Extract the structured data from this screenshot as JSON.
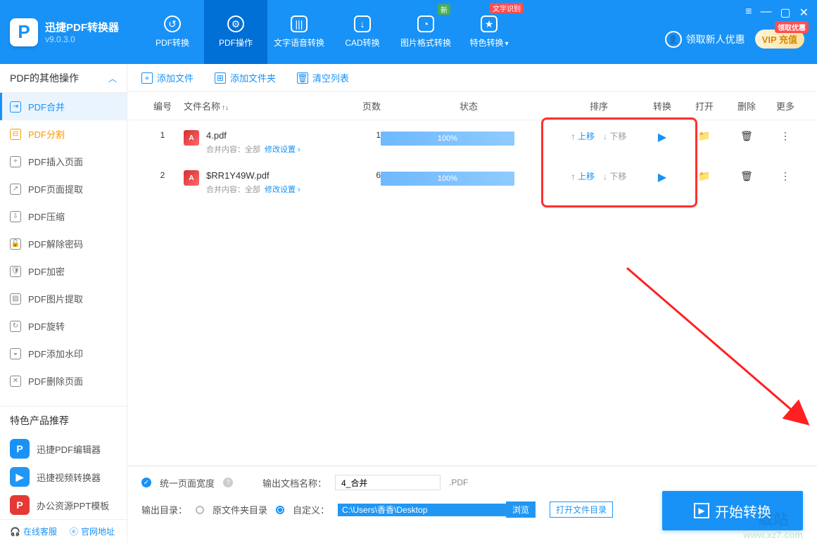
{
  "app": {
    "name": "迅捷PDF转换器",
    "version": "v9.0.3.0"
  },
  "window": {
    "menu": "≡",
    "min": "—",
    "max": "▢",
    "close": "✕"
  },
  "nav": [
    {
      "label": "PDF转换",
      "icon": "↺"
    },
    {
      "label": "PDF操作",
      "icon": "⚙"
    },
    {
      "label": "文字语音转换",
      "icon": "|||"
    },
    {
      "label": "CAD转换",
      "icon": "↓"
    },
    {
      "label": "图片格式转换",
      "icon": "◔",
      "badge": "新"
    },
    {
      "label": "特色转换",
      "icon": "★",
      "drop": true,
      "badge_red": "文字识别"
    }
  ],
  "headerRight": {
    "user": "领取新人优惠",
    "vip": "VIP 充值",
    "vip_badge": "领取优惠"
  },
  "sidebar": {
    "group": "PDF的其他操作",
    "items": [
      "PDF合并",
      "PDF分割",
      "PDF插入页面",
      "PDF页面提取",
      "PDF压缩",
      "PDF解除密码",
      "PDF加密",
      "PDF图片提取",
      "PDF旋转",
      "PDF添加水印",
      "PDF删除页面"
    ],
    "recommend_title": "特色产品推荐",
    "recommends": [
      {
        "label": "迅捷PDF编辑器",
        "color": "#1892f7"
      },
      {
        "label": "迅捷视频转换器",
        "color": "#ff9800"
      },
      {
        "label": "办公资源PPT模板",
        "color": "#e53935"
      }
    ],
    "footer": {
      "service": "在线客服",
      "site": "官网地址"
    }
  },
  "toolbar": {
    "add_file": "添加文件",
    "add_folder": "添加文件夹",
    "clear": "清空列表"
  },
  "columns": {
    "idx": "编号",
    "name": "文件名称",
    "pages": "页数",
    "status": "状态",
    "sort": "排序",
    "conv": "转换",
    "open": "打开",
    "del": "删除",
    "more": "更多"
  },
  "rows": [
    {
      "idx": "1",
      "name": "4.pdf",
      "pages": "1",
      "progress": "100%",
      "meta_label": "合并内容：全部",
      "modify": "修改设置",
      "sort_up": "上移",
      "sort_down": "下移"
    },
    {
      "idx": "2",
      "name": "$RR1Y49W.pdf",
      "pages": "6",
      "progress": "100%",
      "meta_label": "合并内容：全部",
      "modify": "修改设置",
      "sort_up": "上移",
      "sort_down": "下移"
    }
  ],
  "bottom": {
    "uniform_width": "统一页面宽度",
    "out_name_label": "输出文档名称：",
    "out_name_value": "4_合并",
    "out_ext": ".PDF",
    "out_dir_label": "输出目录：",
    "radio_same": "原文件夹目录",
    "radio_custom": "自定义：",
    "path": "C:\\Users\\香香\\Desktop",
    "browse": "浏览",
    "open_dir": "打开文件目录",
    "start": "开始转换"
  },
  "watermark": {
    "site": "www.xz7.com",
    "tag": "载站"
  }
}
